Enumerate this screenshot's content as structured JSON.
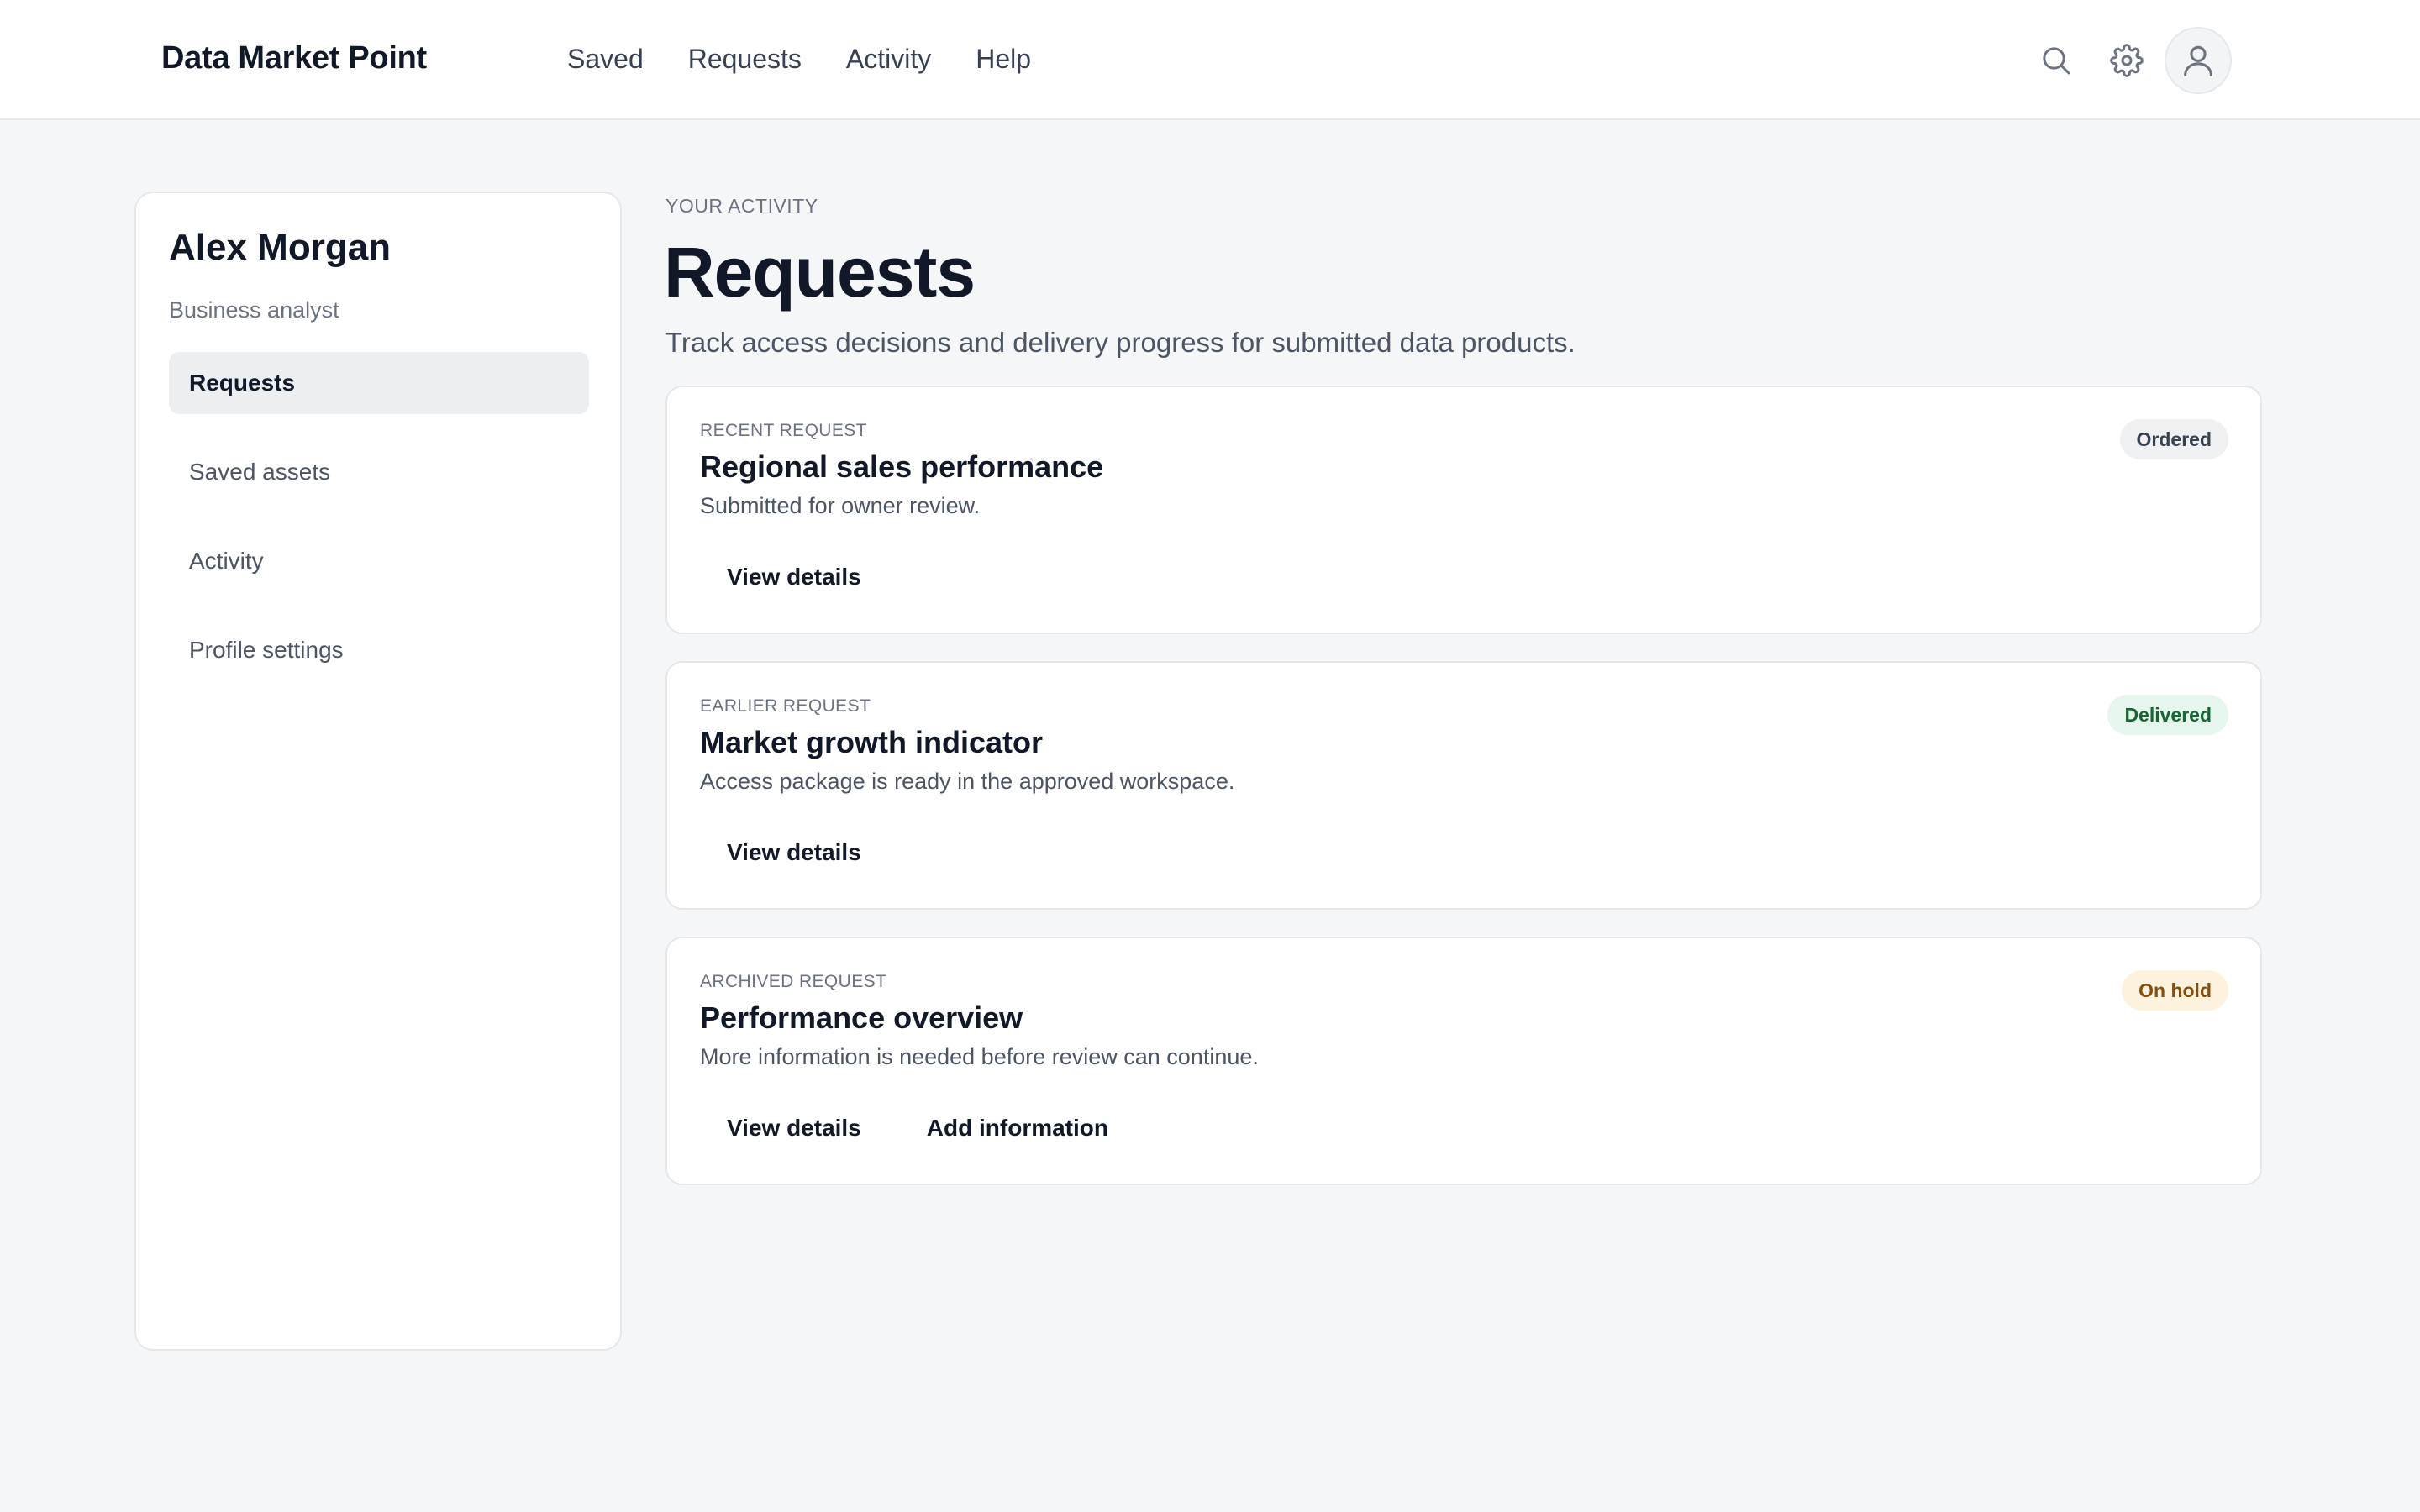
{
  "header": {
    "brand": "Data Market Point",
    "nav": [
      "Saved",
      "Requests",
      "Activity",
      "Help"
    ],
    "icons": [
      "search-icon",
      "gear-icon",
      "user-icon"
    ]
  },
  "sidebar": {
    "user_name": "Alex Morgan",
    "user_role": "Business analyst",
    "items": [
      {
        "label": "Requests",
        "active": true
      },
      {
        "label": "Saved assets",
        "active": false
      },
      {
        "label": "Activity",
        "active": false
      },
      {
        "label": "Profile settings",
        "active": false
      }
    ]
  },
  "main": {
    "eyebrow": "YOUR ACTIVITY",
    "title": "Requests",
    "description": "Track access decisions and delivery progress for submitted data products."
  },
  "cards": [
    {
      "eyebrow": "RECENT REQUEST",
      "title": "Regional sales performance",
      "description": "Submitted for owner review.",
      "status": "Ordered",
      "status_bg": "#eef0f2",
      "status_color": "#374151",
      "actions": [
        "View details"
      ]
    },
    {
      "eyebrow": "EARLIER REQUEST",
      "title": "Market growth indicator",
      "description": "Access package is ready in the approved workspace.",
      "status": "Delivered",
      "status_bg": "#e6f6ec",
      "status_color": "#166534",
      "actions": [
        "View details"
      ]
    },
    {
      "eyebrow": "ARCHIVED REQUEST",
      "title": "Performance overview",
      "description": "More information is needed before review can continue.",
      "status": "On hold",
      "status_bg": "#fdf3dc",
      "status_color": "#854d0e",
      "actions": [
        "View details",
        "Add information"
      ]
    }
  ]
}
